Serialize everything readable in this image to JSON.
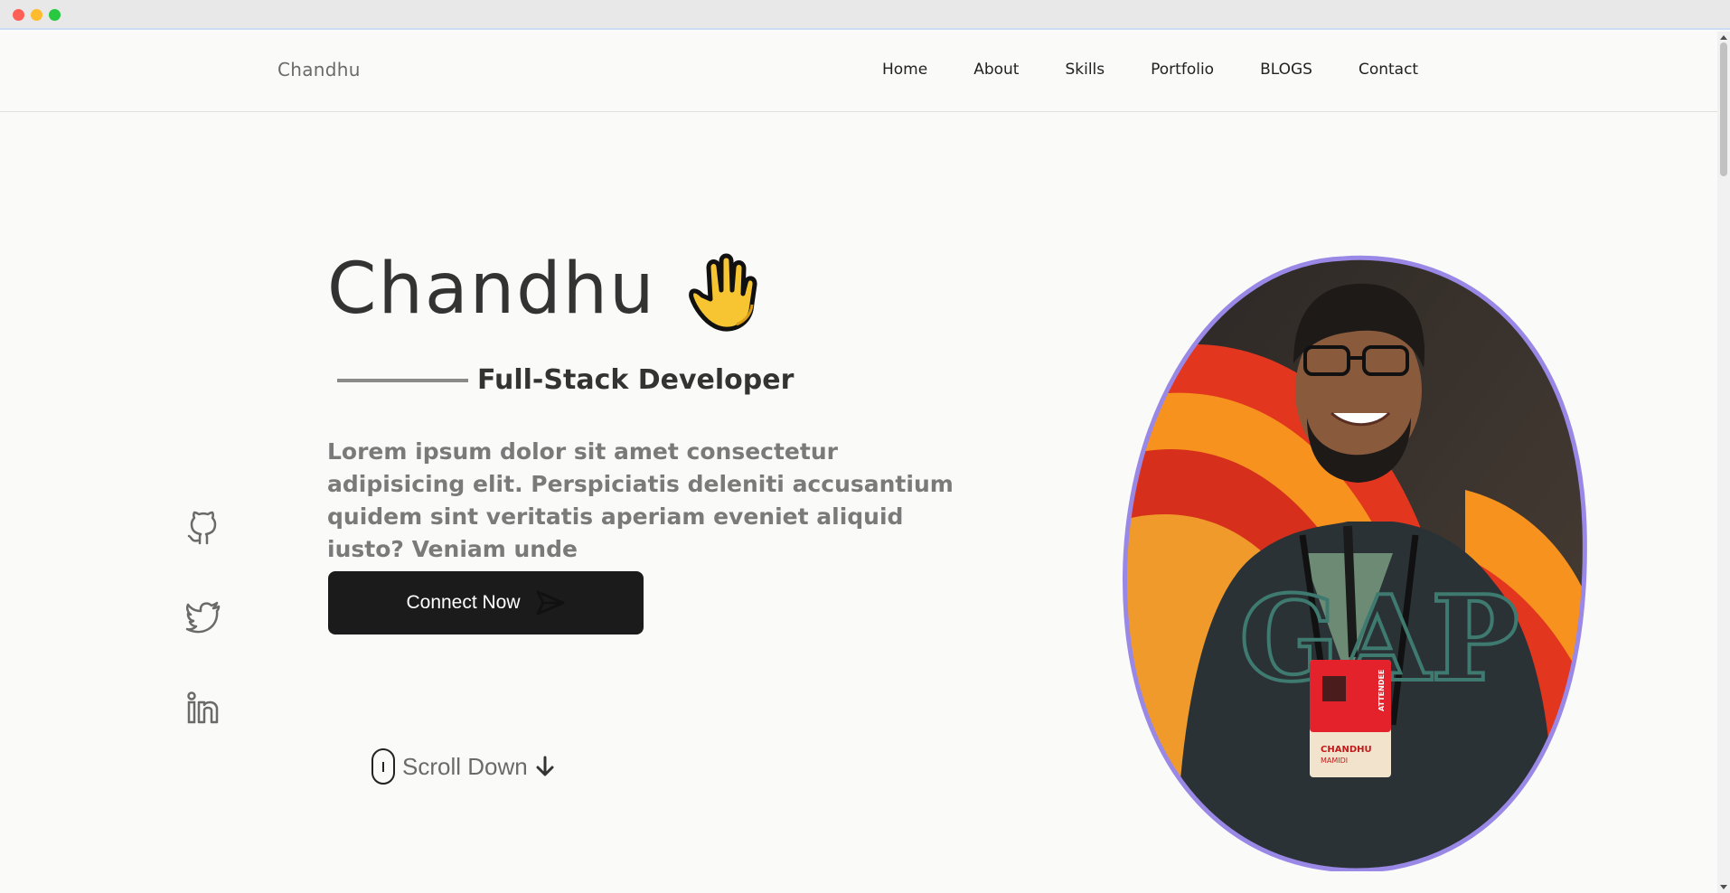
{
  "window": {
    "controls": [
      "close",
      "minimize",
      "zoom"
    ]
  },
  "header": {
    "logo": "Chandhu",
    "nav": [
      {
        "label": "Home"
      },
      {
        "label": "About"
      },
      {
        "label": "Skills"
      },
      {
        "label": "Portfolio"
      },
      {
        "label": "BLOGS"
      },
      {
        "label": "Contact"
      }
    ]
  },
  "hero": {
    "name": "Chandhu",
    "wave_icon": "waving-hand-icon",
    "subtitle": "Full-Stack Developer",
    "description": "Lorem ipsum dolor sit amet consectetur adipisicing elit. Perspiciatis deleniti accusantium quidem sint veritatis aperiam eveniet aliquid iusto? Veniam unde",
    "cta_label": "Connect Now",
    "cta_icon": "send-icon",
    "scroll_label": "Scroll Down"
  },
  "socials": [
    {
      "icon": "github-icon"
    },
    {
      "icon": "twitter-icon"
    },
    {
      "icon": "linkedin-icon"
    }
  ],
  "portrait": {
    "badge_name": "CHANDHU",
    "badge_surname": "MAMIDI",
    "badge_role": "ATTENDEE",
    "shirt_text": "GAP"
  },
  "colors": {
    "background": "#fafaf8",
    "portrait_border": "#9a88e6",
    "button": "#1b1b1b",
    "text_dark": "#333333",
    "text_muted": "#7a7a7a"
  }
}
